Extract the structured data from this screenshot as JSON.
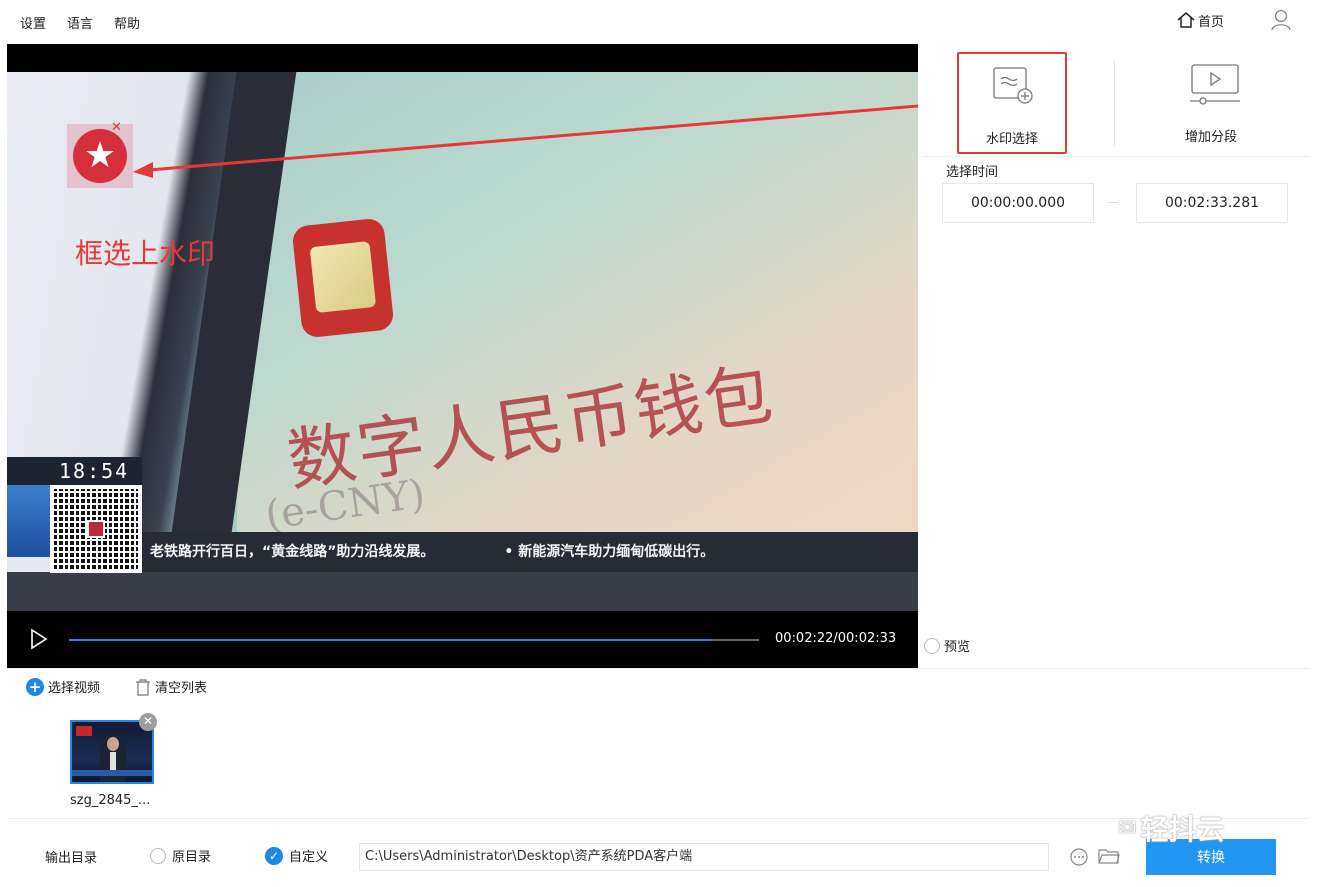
{
  "menu": {
    "settings": "设置",
    "language": "语言",
    "help": "帮助"
  },
  "header": {
    "home_label": "首页"
  },
  "video": {
    "annotation": "框选上水印",
    "overlay_title": "数字人民币钱包",
    "overlay_sub": "(e-CNY)",
    "clock": "18:54",
    "ticker_1": "老铁路开行百日，“黄金线路”助力沿线发展。",
    "ticker_2": "• 新能源汽车助力缅甸低碳出行。",
    "time_display": "00:02:22/00:02:33",
    "progress": 0.93
  },
  "tools": {
    "watermark_label": "水印选择",
    "segment_label": "增加分段"
  },
  "time_select": {
    "label": "选择时间",
    "start": "00:00:00.000",
    "end": "00:02:33.281"
  },
  "preview_label": "预览",
  "list": {
    "select_video": "选择视频",
    "clear_list": "清空列表",
    "items": [
      {
        "name": "szg_2845_..."
      }
    ]
  },
  "output": {
    "label": "输出目录",
    "option_original": "原目录",
    "option_custom": "自定义",
    "path": "C:\\Users\\Administrator\\Desktop\\资产系统PDA客户端",
    "convert_label": "转换"
  },
  "brand": "轻抖云",
  "colors": {
    "accent": "#1e88e5",
    "annotation": "#e53935"
  }
}
